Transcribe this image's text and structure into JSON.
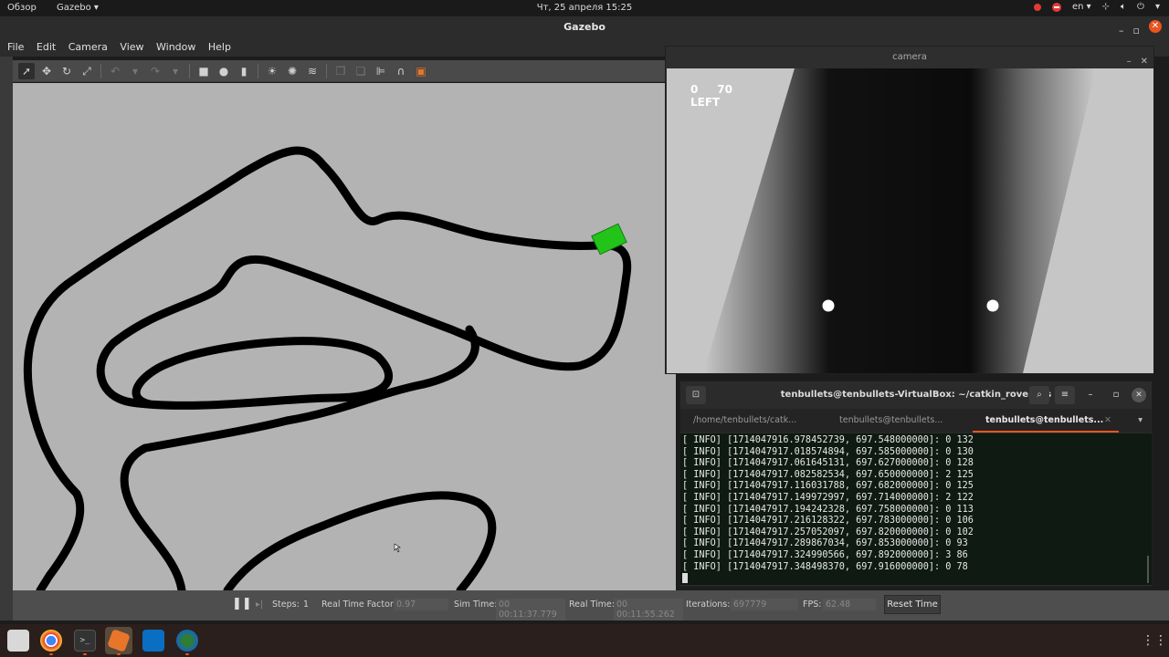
{
  "topbar": {
    "overview": "Обзор",
    "app_menu": "Gazebo ▾",
    "clock": "Чт, 25 апреля  15:25",
    "lang": "en ▾"
  },
  "gazebo": {
    "title": "Gazebo",
    "menu": [
      "File",
      "Edit",
      "Camera",
      "View",
      "Window",
      "Help"
    ],
    "toolbar_icons": [
      "select-icon",
      "translate-icon",
      "rotate-icon",
      "scale-icon",
      "undo-icon",
      "redo-icon",
      "box-icon",
      "sphere-icon",
      "cylinder-icon",
      "point-light-icon",
      "spot-light-icon",
      "directional-light-icon",
      "copy-icon",
      "paste-icon",
      "align-icon",
      "snap-icon",
      "screenshot-icon"
    ],
    "bottom": {
      "steps_label": "Steps:",
      "steps_value": "1",
      "rtf_label": "Real Time Factor:",
      "rtf_value": "0.97",
      "sim_time_label": "Sim Time:",
      "sim_time_value": "00 00:11:37.779",
      "real_time_label": "Real Time:",
      "real_time_value": "00 00:11:55.262",
      "iterations_label": "Iterations:",
      "iterations_value": "697779",
      "fps_label": "FPS:",
      "fps_value": "62.48",
      "reset_label": "Reset Time"
    },
    "track_color": "#000000",
    "ground_color": "#b3b3b3",
    "robot_color": "#22c41a"
  },
  "camera": {
    "title": "camera",
    "overlay_line1": "0     70",
    "overlay_line2": "LEFT"
  },
  "terminal": {
    "title": "tenbullets@tenbullets-VirtualBox: ~/catkin_rover_ws",
    "tabs": [
      {
        "label": "/home/tenbullets/catk..."
      },
      {
        "label": "tenbullets@tenbullets..."
      },
      {
        "label": "tenbullets@tenbullets..."
      }
    ],
    "lines": [
      "[ INFO] [1714047916.978452739, 697.548000000]: 0 132",
      "[ INFO] [1714047917.018574894, 697.585000000]: 0 130",
      "[ INFO] [1714047917.061645131, 697.627000000]: 0 128",
      "[ INFO] [1714047917.082582534, 697.650000000]: 2 125",
      "[ INFO] [1714047917.116031788, 697.682000000]: 0 125",
      "[ INFO] [1714047917.149972997, 697.714000000]: 2 122",
      "[ INFO] [1714047917.194242328, 697.758000000]: 0 113",
      "[ INFO] [1714047917.216128322, 697.783000000]: 0 106",
      "[ INFO] [1714047917.257052097, 697.820000000]: 0 102",
      "[ INFO] [1714047917.289867034, 697.853000000]: 0 93",
      "[ INFO] [1714047917.324990566, 697.892000000]: 3 86",
      "[ INFO] [1714047917.348498370, 697.916000000]: 0 78"
    ]
  },
  "dock": {
    "apps": [
      "files-icon",
      "chrome-icon",
      "terminal-icon",
      "gazebo-icon",
      "vscode-icon",
      "rviz-icon"
    ],
    "grid": "show-apps-icon"
  }
}
